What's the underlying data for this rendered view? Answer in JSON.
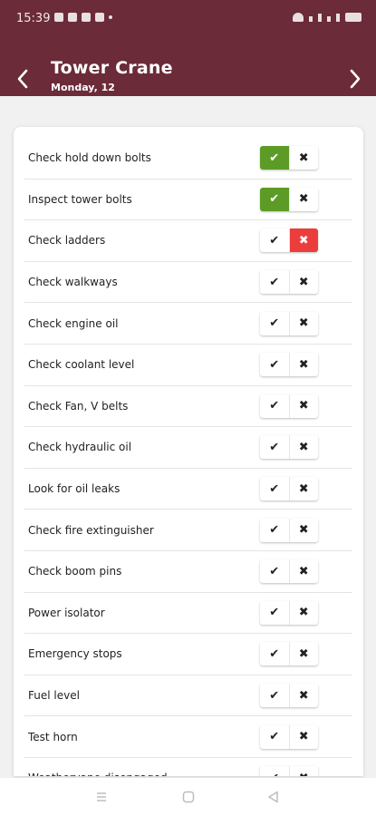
{
  "status_bar": {
    "time": "15:39"
  },
  "header": {
    "title": "Tower Crane",
    "subtitle": "Monday, 12"
  },
  "checklist": [
    {
      "label": "Check hold down bolts",
      "state": "yes"
    },
    {
      "label": "Inspect tower bolts",
      "state": "yes"
    },
    {
      "label": "Check ladders",
      "state": "no"
    },
    {
      "label": "Check walkways",
      "state": "none"
    },
    {
      "label": "Check engine oil",
      "state": "none"
    },
    {
      "label": "Check coolant level",
      "state": "none"
    },
    {
      "label": "Check Fan, V belts",
      "state": "none"
    },
    {
      "label": "Check hydraulic oil",
      "state": "none"
    },
    {
      "label": "Look for oil leaks",
      "state": "none"
    },
    {
      "label": "Check fire extinguisher",
      "state": "none"
    },
    {
      "label": "Check boom pins",
      "state": "none"
    },
    {
      "label": "Power isolator",
      "state": "none"
    },
    {
      "label": "Emergency stops",
      "state": "none"
    },
    {
      "label": "Fuel level",
      "state": "none"
    },
    {
      "label": "Test horn",
      "state": "none"
    },
    {
      "label": "Weathervane disengaged",
      "state": "none"
    }
  ],
  "toggle_symbols": {
    "yes": "✔",
    "no": "✖"
  },
  "colors": {
    "header_bg": "#6b2b39",
    "yes_active": "#5c9c26",
    "no_active": "#ec3d3d"
  },
  "icons": {
    "back": "chevron-left-icon",
    "next": "chevron-right-icon",
    "nav_menu": "menu-icon",
    "nav_home": "square-home-icon",
    "nav_back": "triangle-back-icon"
  }
}
